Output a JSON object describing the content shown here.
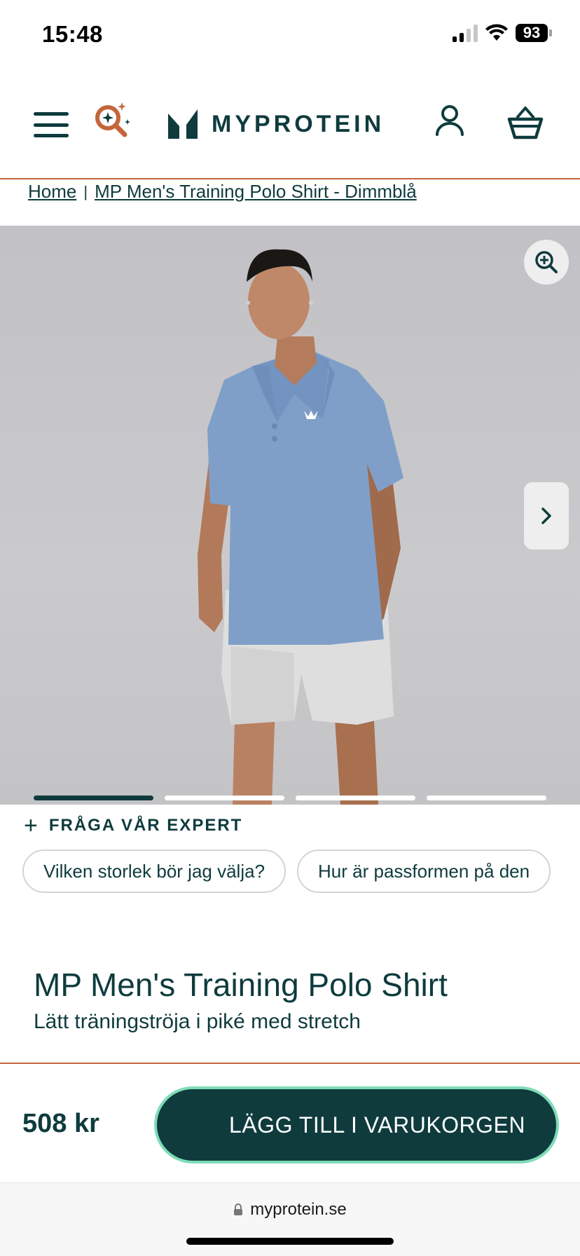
{
  "status_bar": {
    "time": "15:48",
    "battery": "93"
  },
  "header": {
    "brand": "MYPROTEIN",
    "icons": [
      "menu-icon",
      "ai-search-icon",
      "myprotein-logo-icon",
      "account-icon",
      "basket-icon"
    ]
  },
  "breadcrumb": {
    "home": "Home",
    "separator": "|",
    "current": "MP Men's Training Polo Shirt - Dimmblå"
  },
  "gallery": {
    "image_count": 4,
    "active_index": 0,
    "icons": [
      "zoom-in-icon",
      "chevron-right-icon"
    ]
  },
  "expert": {
    "label": "FRÅGA VÅR EXPERT",
    "questions": [
      "Vilken storlek bör jag välja?",
      "Hur är passformen på den"
    ]
  },
  "product": {
    "title": "MP Men's Training Polo Shirt",
    "subtitle": "Lätt träningströja i piké med stretch",
    "price": "508 kr"
  },
  "cta": {
    "add_to_cart": "LÄGG TILL I VARUKORGEN"
  },
  "browser": {
    "url": "myprotein.se"
  },
  "colors": {
    "brand_dark": "#0f3b3d",
    "accent_orange": "#c4653a",
    "accent_mint": "#7fdcb7",
    "shirt_blue": "#7f9fc8"
  }
}
